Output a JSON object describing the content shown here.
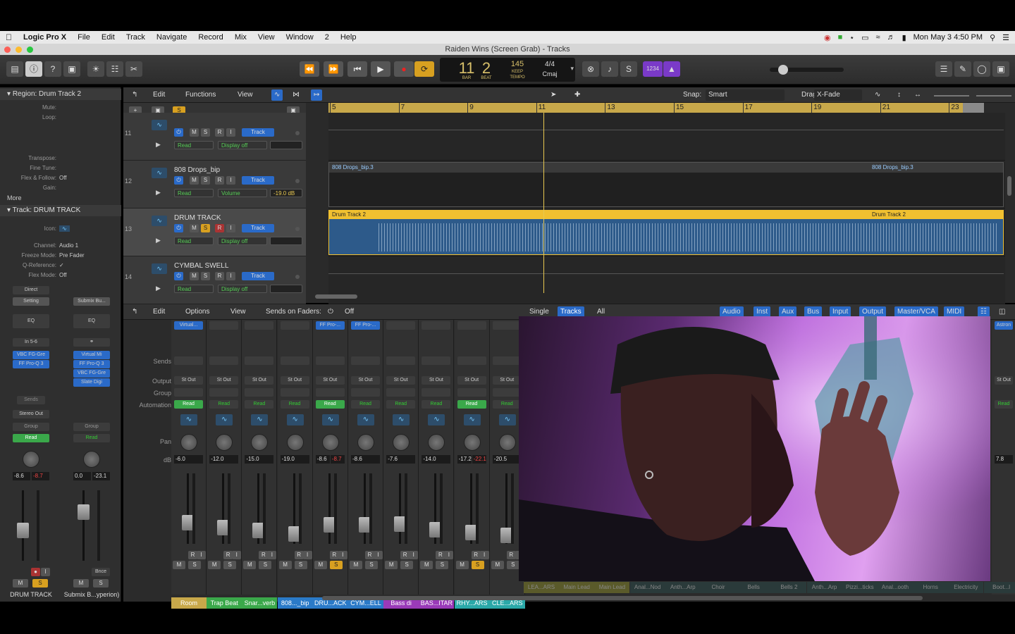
{
  "menubar": {
    "apple": "",
    "app": "Logic Pro X",
    "items": [
      "File",
      "Edit",
      "Track",
      "Navigate",
      "Record",
      "Mix",
      "View",
      "Window",
      "2",
      "Help"
    ],
    "clock": "Mon May 3  4:50 PM"
  },
  "window": {
    "title": "Raiden Wins (Screen Grab) - Tracks"
  },
  "lcd": {
    "bar": "11",
    "beat": "2",
    "bar_label": "BAR",
    "beat_label": "BEAT",
    "tempo": "145",
    "keep": "KEEP",
    "tempo_label": "TEMPO",
    "sig": "4/4",
    "key": "Cmaj"
  },
  "toolbar": {
    "count_in": "1234"
  },
  "inspector": {
    "region_header": "Region: Drum Track 2",
    "region_rows": [
      {
        "label": "Mute:",
        "value": ""
      },
      {
        "label": "Loop:",
        "value": ""
      },
      {
        "label": "Transpose:",
        "value": ""
      },
      {
        "label": "Fine Tune:",
        "value": ""
      },
      {
        "label": "Flex & Follow:",
        "value": "Off"
      },
      {
        "label": "Gain:",
        "value": ""
      }
    ],
    "more": "More",
    "track_header": "Track:  DRUM TRACK",
    "track_rows": [
      {
        "label": "Icon:",
        "value": ""
      },
      {
        "label": "Channel:",
        "value": "Audio 1"
      },
      {
        "label": "Freeze Mode:",
        "value": "Pre Fader"
      },
      {
        "label": "Q-Reference:",
        "value": "✓"
      },
      {
        "label": "Flex Mode:",
        "value": "Off"
      }
    ],
    "strip1": {
      "direct": "Direct",
      "setting": "Setting",
      "eq": "EQ",
      "input": "In 5-6",
      "plugins": [
        "VBC FG-Gre",
        "FF Pro-Q 3"
      ],
      "sends": "Sends",
      "output": "Stereo Out",
      "group": "Group",
      "automation": "Read",
      "db_a": "-8.6",
      "db_b": "-8.7",
      "name": "DRUM TRACK"
    },
    "strip2": {
      "setting": "Submix Bu...",
      "eq": "EQ",
      "plugins": [
        "Virtual Mi",
        "FF Pro-Q 3",
        "VBC FG-Gre",
        "Slate Digi"
      ],
      "group": "Group",
      "automation": "Read",
      "db_a": "0.0",
      "db_b": "-23.1",
      "bnce": "Bnce",
      "name": "Submix B...yperion)"
    }
  },
  "tracks_bar": {
    "edit": "Edit",
    "functions": "Functions",
    "view": "View",
    "snap_label": "Snap:",
    "snap": "Smart",
    "drag_label": "Drag:",
    "drag": "X-Fade"
  },
  "ruler": [
    "5",
    "7",
    "9",
    "11",
    "13",
    "15",
    "17",
    "19",
    "21",
    "23"
  ],
  "tracks": [
    {
      "num": "11",
      "name": "",
      "auto": "Read",
      "param": "Display off",
      "value": "",
      "track_btn": "Track"
    },
    {
      "num": "12",
      "name": "808 Drops_bip",
      "auto": "Read",
      "param": "Volume",
      "value": "-19.0 dB",
      "track_btn": "Track",
      "region": "808 Drops_bip.3",
      "region2": "808 Drops_bip.3"
    },
    {
      "num": "13",
      "name": "DRUM TRACK",
      "auto": "Read",
      "param": "Display off",
      "value": "",
      "track_btn": "Track",
      "region": "Drum Track 2",
      "region2": "Drum Track 2"
    },
    {
      "num": "14",
      "name": "CYMBAL SWELL",
      "auto": "Read",
      "param": "Display off",
      "value": "",
      "track_btn": "Track"
    }
  ],
  "mixer_bar": {
    "edit": "Edit",
    "options": "Options",
    "view": "View",
    "sends_on_faders": "Sends on Faders:",
    "sends_value": "Off",
    "tabs": [
      "Single",
      "Tracks",
      "All"
    ],
    "filters": [
      "Audio",
      "Inst",
      "Aux",
      "Bus",
      "Input",
      "Output",
      "Master/VCA",
      "MIDI"
    ]
  },
  "mixer_labels": {
    "sends": "Sends",
    "output": "Output",
    "group": "Group",
    "automation": "Automation",
    "pan": "Pan",
    "db": "dB"
  },
  "strips": [
    {
      "name": "Room",
      "plugin": "Virtual...",
      "out": "St Out",
      "auto": "Read",
      "db": "-6.0",
      "db2": "",
      "color": "#c8a84a"
    },
    {
      "name": "Trap Beat",
      "plugin": "",
      "out": "St Out",
      "auto": "Read",
      "db": "-12.0",
      "db2": "",
      "color": "#3aa84a"
    },
    {
      "name": "Snar...verb",
      "plugin": "",
      "out": "St Out",
      "auto": "Read",
      "db": "-15.0",
      "db2": "",
      "color": "#3aa84a"
    },
    {
      "name": "808..._bip",
      "plugin": "",
      "out": "St Out",
      "auto": "Read",
      "db": "-19.0",
      "db2": "",
      "color": "#2a7ac8"
    },
    {
      "name": "DRU...ACK",
      "plugin": "FF Pro-...",
      "out": "St Out",
      "auto": "Read",
      "db": "-8.6",
      "db2": "-8.7",
      "color": "#2a7ac8"
    },
    {
      "name": "CYM...ELL",
      "plugin": "FF Pro-...",
      "out": "St Out",
      "auto": "Read",
      "db": "-8.6",
      "db2": "",
      "color": "#2a7ac8"
    },
    {
      "name": "Bass di",
      "plugin": "",
      "out": "St Out",
      "auto": "Read",
      "db": "-7.6",
      "db2": "",
      "color": "#9a3ab8"
    },
    {
      "name": "BAS...ITAR",
      "plugin": "",
      "out": "St Out",
      "auto": "Read",
      "db": "-14.0",
      "db2": "",
      "color": "#9a3ab8"
    },
    {
      "name": "RHY...ARS",
      "plugin": "",
      "out": "St Out",
      "auto": "Read",
      "db": "-17.2",
      "db2": "-22.1",
      "color": "#2aa8a8"
    },
    {
      "name": "CLE...ARS",
      "plugin": "",
      "out": "St Out",
      "auto": "Read",
      "db": "-20.5",
      "db2": "",
      "color": "#2aa8a8"
    }
  ],
  "hidden_strip_names": [
    "LEA...ARS",
    "Main Lead",
    "Main Lead",
    "Anal...Nod",
    "Anth...Arp",
    "Choir",
    "Bells",
    "Bells 2",
    "Anth...Arp",
    "Pizzi...ticks",
    "Anal...ooth",
    "Horns",
    "Electricity",
    "Boot...l"
  ],
  "right_strip": {
    "plugin": "Astron",
    "out": "St Out",
    "auto": "Read",
    "db": "7.8"
  },
  "colors": {
    "accent": "#2a7ac8",
    "region_yellow": "#f0c030",
    "playhead": "#e8c850"
  }
}
